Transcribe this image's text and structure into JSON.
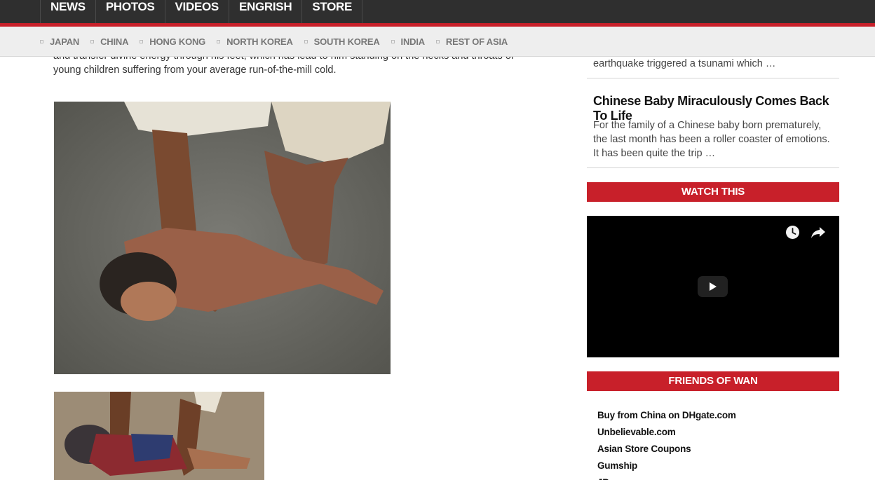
{
  "top_nav": {
    "items": [
      {
        "label": "NEWS"
      },
      {
        "label": "PHOTOS"
      },
      {
        "label": "VIDEOS"
      },
      {
        "label": "ENGRISH"
      },
      {
        "label": "STORE"
      }
    ]
  },
  "sub_nav": {
    "items": [
      {
        "label": "JAPAN"
      },
      {
        "label": "CHINA"
      },
      {
        "label": "HONG KONG"
      },
      {
        "label": "NORTH KOREA"
      },
      {
        "label": "SOUTH KOREA"
      },
      {
        "label": "INDIA"
      },
      {
        "label": "REST OF ASIA"
      }
    ]
  },
  "article": {
    "paragraph_partial": "and transfer divine energy through his feet, which has lead to him standing on the necks and throats of young children suffering from your average run-of-the-mill cold."
  },
  "sidebar": {
    "prev_snippet": "earthquake triggered a tsunami which …",
    "story": {
      "title": "Chinese Baby Miraculously Comes Back To Life",
      "excerpt": "For the family of a Chinese baby born prematurely, the last month has been a roller coaster of emotions. It has been quite the trip …"
    },
    "watch_header": "WATCH THIS",
    "friends_header": "FRIENDS OF WAN",
    "friends_links": [
      {
        "label": "Buy from China on DHgate.com"
      },
      {
        "label": "Unbelievable.com"
      },
      {
        "label": "Asian Store Coupons"
      },
      {
        "label": "Gumship"
      },
      {
        "label": "JBox"
      }
    ]
  },
  "colors": {
    "accent_red": "#c8202a",
    "nav_dark": "#2f2f2f",
    "subnav_bg": "#eeeeee"
  },
  "icons": {
    "video_watch_later": "clock-icon",
    "video_share": "share-icon",
    "video_play": "play-icon"
  }
}
